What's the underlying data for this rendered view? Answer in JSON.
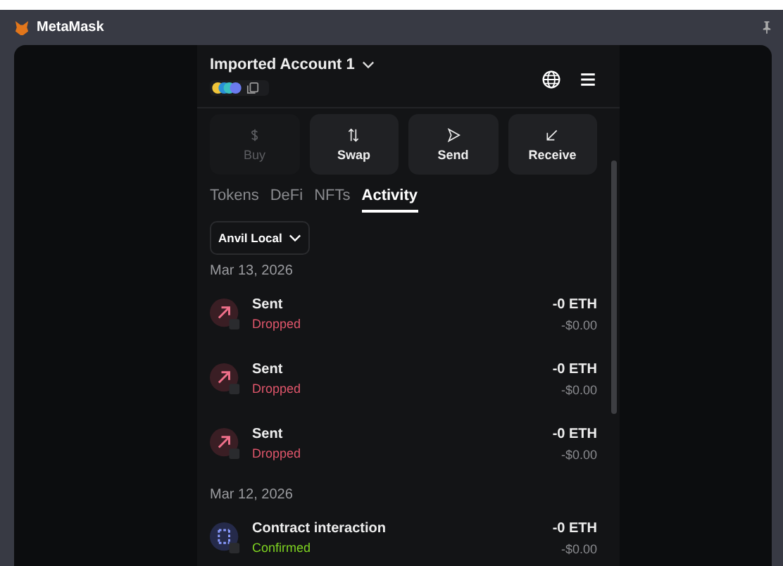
{
  "window": {
    "title": "MetaMask"
  },
  "account": {
    "name": "Imported Account 1"
  },
  "actions": [
    {
      "label": "Buy",
      "kind": "buy",
      "disabled": true
    },
    {
      "label": "Swap",
      "kind": "swap",
      "disabled": false
    },
    {
      "label": "Send",
      "kind": "send",
      "disabled": false
    },
    {
      "label": "Receive",
      "kind": "receive",
      "disabled": false
    }
  ],
  "tabs": [
    {
      "label": "Tokens",
      "selected": false
    },
    {
      "label": "DeFi",
      "selected": false
    },
    {
      "label": "NFTs",
      "selected": false
    },
    {
      "label": "Activity",
      "selected": true
    }
  ],
  "network_filter": {
    "label": "Anvil Local"
  },
  "groups": [
    {
      "date": "Mar 13, 2026",
      "items": [
        {
          "kind": "sent",
          "title": "Sent",
          "status": "Dropped",
          "color": "#e0566b",
          "amount": "-0 ETH",
          "fiat": "-$0.00"
        },
        {
          "kind": "sent",
          "title": "Sent",
          "status": "Dropped",
          "color": "#e0566b",
          "amount": "-0 ETH",
          "fiat": "-$0.00"
        },
        {
          "kind": "sent",
          "title": "Sent",
          "status": "Dropped",
          "color": "#e0566b",
          "amount": "-0 ETH",
          "fiat": "-$0.00"
        }
      ]
    },
    {
      "date": "Mar 12, 2026",
      "items": [
        {
          "kind": "contract",
          "title": "Contract interaction",
          "status": "Confirmed",
          "color": "#7ed321",
          "amount": "-0 ETH",
          "fiat": "-$0.00"
        }
      ]
    }
  ]
}
